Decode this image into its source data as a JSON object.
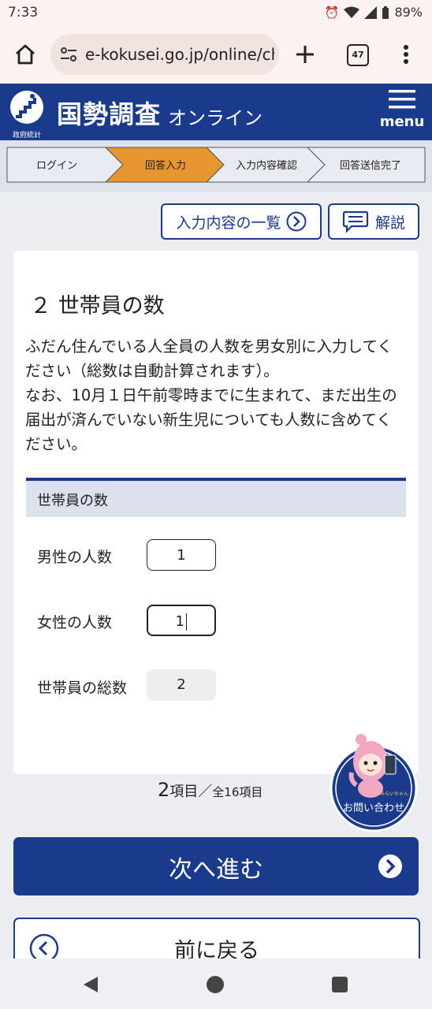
{
  "status_bar": {
    "time": "7:33",
    "battery": "89%"
  },
  "browser": {
    "url": "e-kokusei.go.jp/online/ch",
    "tab_count": "47"
  },
  "site": {
    "logo_caption": "政府統計",
    "title": "国勢調査",
    "subtitle": "オンライン",
    "menu_label": "menu"
  },
  "steps": [
    {
      "label": "ログイン",
      "active": false
    },
    {
      "label": "回答入力",
      "active": true
    },
    {
      "label": "入力内容確認",
      "active": false
    },
    {
      "label": "回答送信完了",
      "active": false
    }
  ],
  "actions": {
    "list_label": "入力内容の一覧",
    "help_label": "解説"
  },
  "question": {
    "title": "２ 世帯員の数",
    "desc1": "ふだん住んでいる人全員の人数を男女別に入力してください（総数は自動計算されます）。",
    "desc2": "なお、10月１日午前零時までに生まれて、まだ出生の届出が済んでいない新生児についても人数に含めてください。"
  },
  "section": {
    "title": "世帯員の数"
  },
  "fields": {
    "male_label": "男性の人数",
    "male_value": "1",
    "female_label": "女性の人数",
    "female_value": "1",
    "total_label": "世帯員の総数",
    "total_value": "2"
  },
  "progress": {
    "current": "2",
    "unit_current": "項目／",
    "total_text": "全16項目"
  },
  "contact": {
    "label": "お問い合わせ",
    "mascot_name": "みらいちゃん"
  },
  "nav": {
    "next_label": "次へ進む",
    "back_label": "前に戻る"
  },
  "colors": {
    "brand": "#1a3a8c",
    "active_step": "#e6952f"
  }
}
